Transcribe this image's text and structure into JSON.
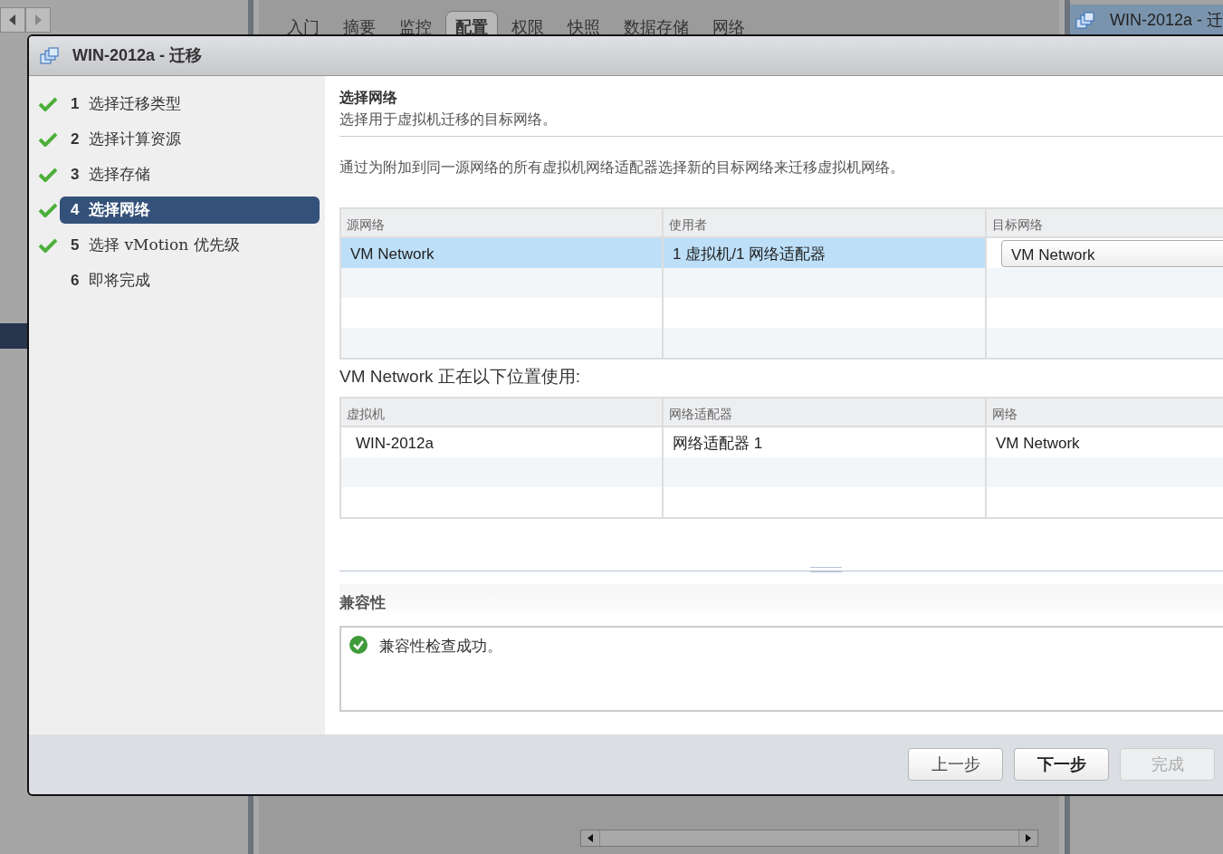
{
  "background": {
    "tabs": [
      {
        "label": "入门",
        "selected": false
      },
      {
        "label": "摘要",
        "selected": false
      },
      {
        "label": "监控",
        "selected": false
      },
      {
        "label": "配置",
        "selected": true
      },
      {
        "label": "权限",
        "selected": false
      },
      {
        "label": "快照",
        "selected": false
      },
      {
        "label": "数据存储",
        "selected": false
      },
      {
        "label": "网络",
        "selected": false
      }
    ],
    "side_panel_title": "WIN-2012a - 迁"
  },
  "dialog": {
    "title": "WIN-2012a - 迁移",
    "steps": [
      {
        "number": "1",
        "label": "选择迁移类型",
        "completed": true,
        "selected": false
      },
      {
        "number": "2",
        "label": "选择计算资源",
        "completed": true,
        "selected": false
      },
      {
        "number": "3",
        "label": "选择存储",
        "completed": true,
        "selected": false
      },
      {
        "number": "4",
        "label": "选择网络",
        "completed": true,
        "selected": true
      },
      {
        "number": "5",
        "label": "选择 vMotion 优先级",
        "completed": true,
        "selected": false
      },
      {
        "number": "6",
        "label": "即将完成",
        "completed": false,
        "selected": false
      }
    ],
    "page": {
      "title": "选择网络",
      "subtitle": "选择用于虚拟机迁移的目标网络。",
      "description": "通过为附加到同一源网络的所有虚拟机网络适配器选择新的目标网络来迁移虚拟机网络。"
    },
    "network_table": {
      "columns": [
        "源网络",
        "使用者",
        "目标网络"
      ],
      "rows": [
        {
          "source": "VM Network",
          "used_by": "1 虚拟机/1 网络适配器",
          "target": "VM Network",
          "selected": true
        }
      ]
    },
    "usage_heading": "VM Network 正在以下位置使用:",
    "usage_table": {
      "columns": [
        "虚拟机",
        "网络适配器",
        "网络"
      ],
      "rows": [
        [
          "WIN-2012a",
          "网络适配器 1",
          "VM Network"
        ]
      ]
    },
    "compatibility": {
      "title": "兼容性",
      "message": "兼容性检查成功。"
    },
    "buttons": [
      {
        "label": "上一步",
        "primary": false,
        "disabled": false
      },
      {
        "label": "下一步",
        "primary": true,
        "disabled": false
      },
      {
        "label": "完成",
        "primary": false,
        "disabled": true
      }
    ]
  }
}
